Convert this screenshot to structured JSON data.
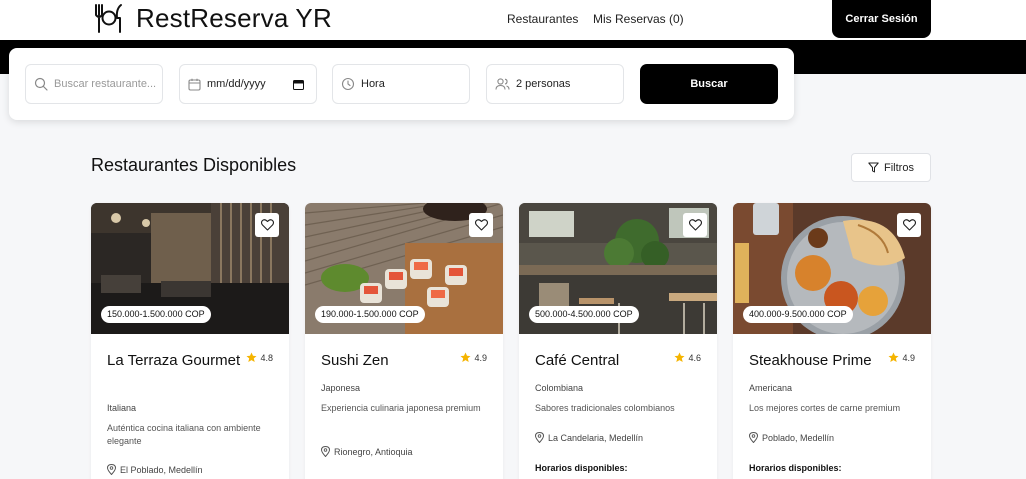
{
  "header": {
    "brand": "RestReserva YR",
    "nav": [
      {
        "label": "Restaurantes"
      },
      {
        "label": "Mis Reservas (0)"
      }
    ],
    "logout_label": "Cerrar Sesión"
  },
  "search": {
    "query_placeholder": "Buscar restaurante...",
    "date_placeholder": "mm/dd/yyyy",
    "time_label": "Hora",
    "party_value": "2 personas",
    "button_label": "Buscar"
  },
  "section": {
    "title": "Restaurantes Disponibles",
    "filter_label": "Filtros"
  },
  "restaurants": [
    {
      "name": "La Terraza Gourmet",
      "rating": "4.8",
      "price": "150.000-1.500.000 COP",
      "cuisine": "Italiana",
      "description": "Auténtica cocina italiana con ambiente elegante",
      "location": "El Poblado, Medellín"
    },
    {
      "name": "Sushi Zen",
      "rating": "4.9",
      "price": "190.000-1.500.000 COP",
      "cuisine": "Japonesa",
      "description": "Experiencia culinaria japonesa premium",
      "location": "Rionegro, Antioquia"
    },
    {
      "name": "Café Central",
      "rating": "4.6",
      "price": "500.000-4.500.000 COP",
      "cuisine": "Colombiana",
      "description": "Sabores tradicionales colombianos",
      "location": "La Candelaria, Medellín",
      "hours_label": "Horarios disponibles:"
    },
    {
      "name": "Steakhouse Prime",
      "rating": "4.9",
      "price": "400.000-9.500.000 COP",
      "cuisine": "Americana",
      "description": "Los mejores cortes de carne premium",
      "location": "Poblado, Medellín",
      "hours_label": "Horarios disponibles:"
    }
  ],
  "colors": {
    "primary": "#000000",
    "background": "#f6f7f9",
    "star": "#f5b400"
  }
}
